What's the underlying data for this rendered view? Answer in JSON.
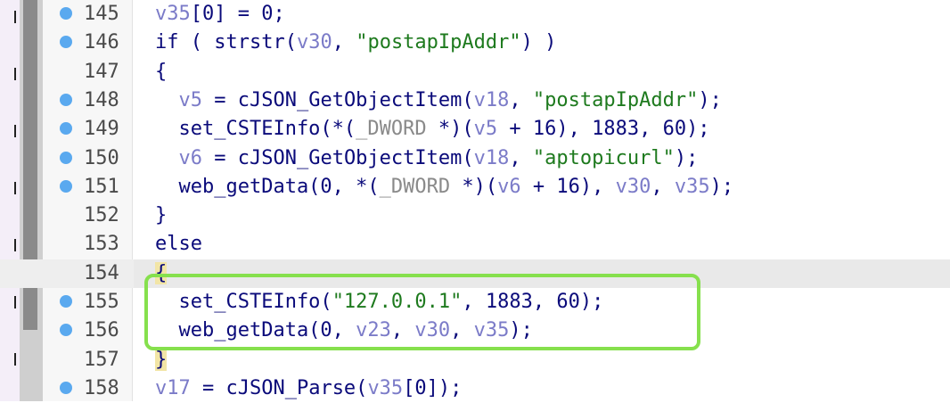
{
  "lines": [
    {
      "num": "145",
      "bp": true,
      "code": "v35[0] = 0;"
    },
    {
      "num": "146",
      "bp": true,
      "code": "if ( strstr(v30, \"postapIpAddr\") )"
    },
    {
      "num": "147",
      "bp": false,
      "code": "{"
    },
    {
      "num": "148",
      "bp": true,
      "code": "  v5 = cJSON_GetObjectItem(v18, \"postapIpAddr\");"
    },
    {
      "num": "149",
      "bp": true,
      "code": "  set_CSTEInfo(*(_DWORD *)(v5 + 16), 1883, 60);"
    },
    {
      "num": "150",
      "bp": true,
      "code": "  v6 = cJSON_GetObjectItem(v18, \"aptopicurl\");"
    },
    {
      "num": "151",
      "bp": true,
      "code": "  web_getData(0, *(_DWORD *)(v6 + 16), v30, v35);"
    },
    {
      "num": "152",
      "bp": false,
      "code": "}"
    },
    {
      "num": "153",
      "bp": false,
      "code": "else"
    },
    {
      "num": "154",
      "bp": false,
      "code": "{"
    },
    {
      "num": "155",
      "bp": true,
      "code": "  set_CSTEInfo(\"127.0.0.1\", 1883, 60);"
    },
    {
      "num": "156",
      "bp": true,
      "code": "  web_getData(0, v23, v30, v35);"
    },
    {
      "num": "157",
      "bp": false,
      "code": "}"
    },
    {
      "num": "158",
      "bp": true,
      "code": "v17 = cJSON_Parse(v35[0]);"
    }
  ],
  "highlighted_line": "154",
  "colors": {
    "keyword": "#0a0a7a",
    "variable": "#7b7bc8",
    "string": "#1e7a1e",
    "breakpoint": "#5aa9ef",
    "highlight_box": "#86e04d"
  }
}
